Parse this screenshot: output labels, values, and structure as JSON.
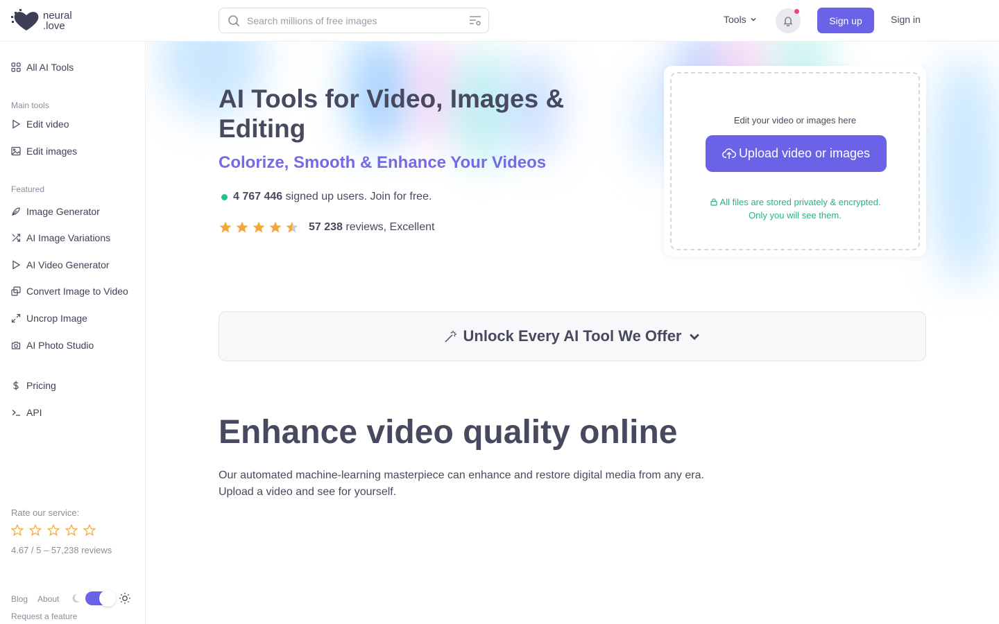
{
  "header": {
    "logo_line1": "neural",
    "logo_line2": ".love",
    "search_placeholder": "Search millions of free images",
    "tools_label": "Tools",
    "signup_label": "Sign up",
    "signin_label": "Sign in"
  },
  "sidebar": {
    "all_tools": "All AI Tools",
    "main_heading": "Main tools",
    "main_items": [
      "Edit video",
      "Edit images"
    ],
    "featured_heading": "Featured",
    "featured_items": [
      "Image Generator",
      "AI Image Variations",
      "AI Video Generator",
      "Convert Image to Video",
      "Uncrop Image",
      "AI Photo Studio"
    ],
    "extra_items": [
      "Pricing",
      "API"
    ],
    "rate_label": "Rate our service:",
    "rate_summary": "4.67 / 5 – 57,238 reviews",
    "footer": {
      "blog": "Blog",
      "about": "About",
      "request": "Request a feature"
    },
    "theme_toggle_on": true
  },
  "hero": {
    "title": "AI Tools for Video, Images & Editing",
    "subtitle": "Colorize, Smooth & Enhance Your Videos",
    "users_count": "4 767 446",
    "users_text": "signed up users. Join for free.",
    "rating_stars": 4.5,
    "reviews_count": "57 238",
    "reviews_text": "reviews, Excellent"
  },
  "upload": {
    "hint": "Edit your video or images here",
    "button_label": "Upload video or images",
    "privacy_line1": "All files are stored privately & encrypted.",
    "privacy_line2": "Only you will see them."
  },
  "unlock": {
    "label": "Unlock Every AI Tool We Offer"
  },
  "section": {
    "heading": "Enhance video quality online",
    "desc_line1": "Our automated machine-learning masterpiece can enhance and restore digital media from any era.",
    "desc_line2": "Upload a video and see for yourself."
  },
  "colors": {
    "accent": "#6a63e8",
    "subtitle": "#7469e6",
    "success": "#22b57f",
    "star": "#f2a93b",
    "text": "#474a5e"
  }
}
